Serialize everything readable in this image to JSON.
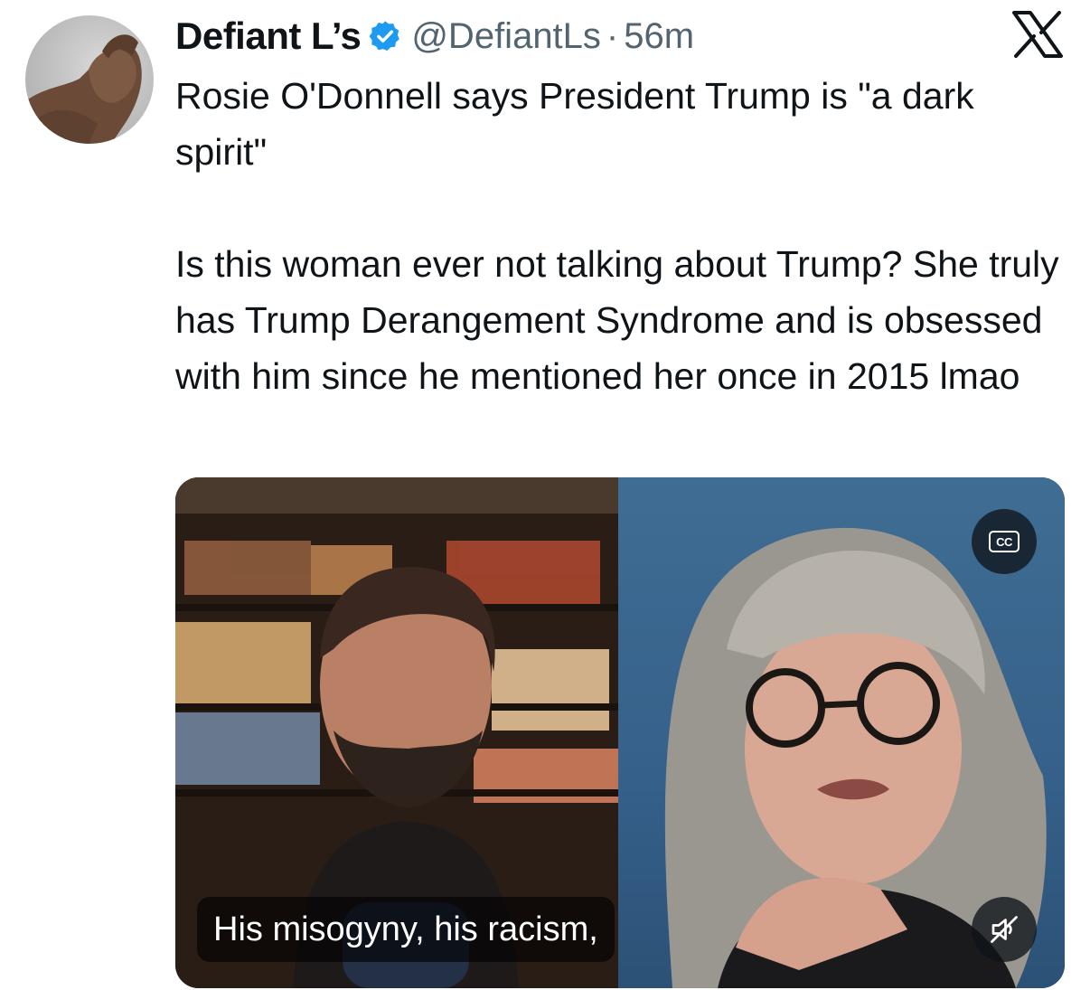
{
  "tweet": {
    "author": {
      "display_name": "Defiant L’s",
      "handle": "@DefiantLs",
      "separator": "·",
      "timestamp": "56m",
      "verified": true,
      "avatar_icon": "avatar-statue-image"
    },
    "text_paragraphs": [
      "Rosie O'Donnell says President Trump is \"a dark spirit\"",
      "Is this woman ever not talking about Trump? She truly has Trump Derangement Syndrome and is obsessed with him since he mentioned her once in 2015 lmao"
    ],
    "brand_icon": "x-logo-icon"
  },
  "media": {
    "type": "video",
    "caption": "His misogyny, his racism,",
    "cc_label": "CC",
    "cc_icon": "closed-captions-icon",
    "mute_icon": "speaker-muted-icon"
  },
  "colors": {
    "text_primary": "#0f1419",
    "text_secondary": "#536471",
    "verified_blue": "#1d9bf0"
  }
}
